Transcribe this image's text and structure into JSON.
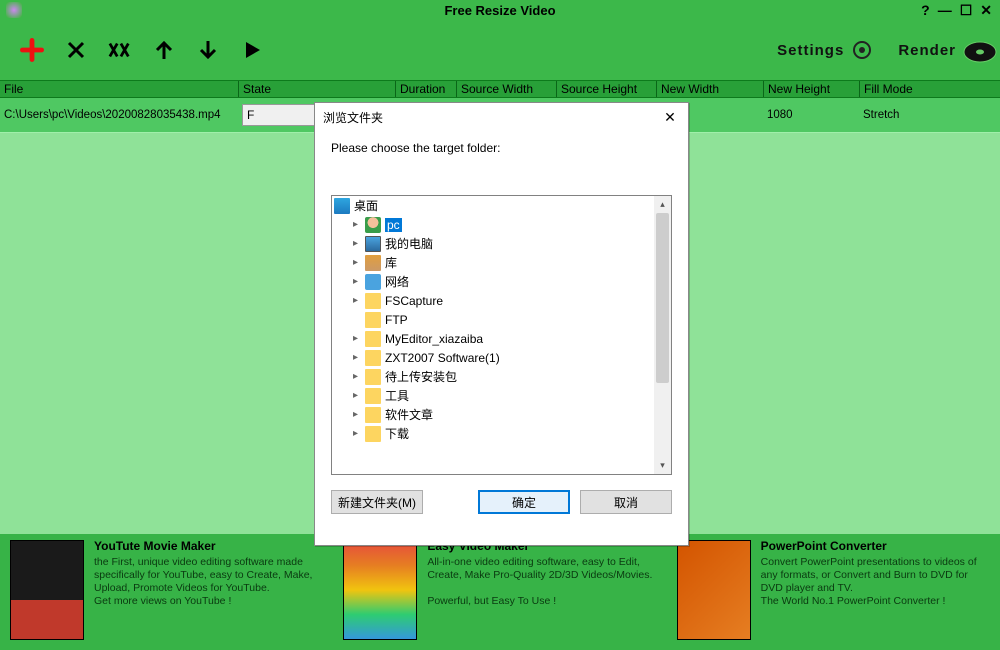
{
  "app": {
    "title": "Free Resize Video"
  },
  "toolbar": {
    "settings_label": "Settings",
    "render_label": "Render"
  },
  "columns": [
    "File",
    "State",
    "Duration",
    "Source Width",
    "Source Height",
    "New Width",
    "New Height",
    "Fill Mode"
  ],
  "row": {
    "file": "C:\\Users\\pc\\Videos\\20200828035438.mp4",
    "state_input": "F",
    "duration": "",
    "source_width": "",
    "source_height": "",
    "new_width": "",
    "new_height": "1080",
    "fill_mode": "Stretch"
  },
  "promos": [
    {
      "title": "YouTute Movie Maker",
      "body": "the First, unique video editing software made specifically for YouTube, easy to Create, Make, Upload, Promote Videos for YouTube.",
      "footer": "Get more views on YouTube !"
    },
    {
      "title": "Easy Video Maker",
      "body": "All-in-one video editing software, easy to Edit, Create, Make Pro-Quality 2D/3D Videos/Movies.",
      "footer": "Powerful, but Easy To Use !"
    },
    {
      "title": "PowerPoint Converter",
      "body": "Convert PowerPoint presentations to videos of any formats, or Convert and Burn to DVD for DVD player and TV.",
      "footer": "The World No.1 PowerPoint Converter !"
    }
  ],
  "dialog": {
    "title": "浏览文件夹",
    "message": "Please choose the target folder:",
    "root": "桌面",
    "nodes": [
      {
        "icon": "user",
        "label": "pc",
        "sel": true,
        "caret": true
      },
      {
        "icon": "pc",
        "label": "我的电脑",
        "caret": true
      },
      {
        "icon": "lib",
        "label": "库",
        "caret": true
      },
      {
        "icon": "net",
        "label": "网络",
        "caret": true
      },
      {
        "icon": "folder",
        "label": "FSCapture",
        "caret": true
      },
      {
        "icon": "folder",
        "label": "FTP",
        "caret": false
      },
      {
        "icon": "folder",
        "label": "MyEditor_xiazaiba",
        "caret": true
      },
      {
        "icon": "folder",
        "label": "ZXT2007 Software(1)",
        "caret": true
      },
      {
        "icon": "folder",
        "label": "待上传安装包",
        "caret": true
      },
      {
        "icon": "folder",
        "label": "工具",
        "caret": true
      },
      {
        "icon": "folder",
        "label": "软件文章",
        "caret": true
      },
      {
        "icon": "folder",
        "label": "下载",
        "caret": true
      }
    ],
    "btn_new": "新建文件夹(M)",
    "btn_ok": "确定",
    "btn_cancel": "取消"
  }
}
